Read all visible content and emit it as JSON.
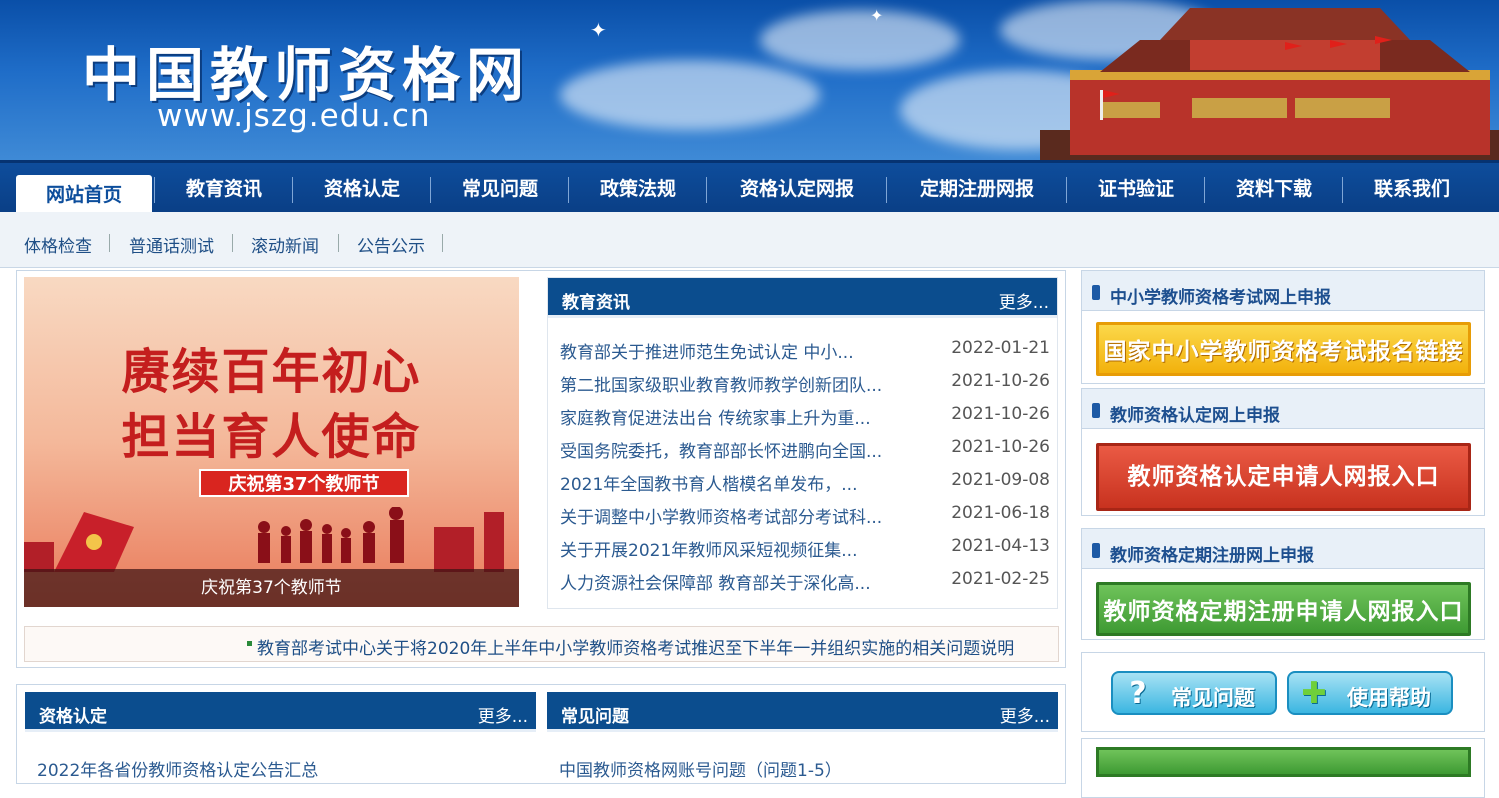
{
  "header": {
    "site_title": "中国教师资格网",
    "site_url": "www.jszg.edu.cn"
  },
  "nav": {
    "items": [
      "网站首页",
      "教育资讯",
      "资格认定",
      "常见问题",
      "政策法规",
      "资格认定网报",
      "定期注册网报",
      "证书验证",
      "资料下载",
      "联系我们"
    ]
  },
  "subnav": {
    "items": [
      "体格检查",
      "普通话测试",
      "滚动新闻",
      "公告公示"
    ]
  },
  "banner": {
    "line1": "赓续百年初心",
    "line2": "担当育人使命",
    "tag": "庆祝第37个教师节",
    "caption": "庆祝第37个教师节"
  },
  "news": {
    "title": "教育资讯",
    "more": "更多...",
    "rows": [
      {
        "title": "教育部关于推进师范生免试认定 中小...",
        "date": "2022-01-21"
      },
      {
        "title": "第二批国家级职业教育教师教学创新团队...",
        "date": "2021-10-26"
      },
      {
        "title": "家庭教育促进法出台 传统家事上升为重...",
        "date": "2021-10-26"
      },
      {
        "title": "受国务院委托，教育部部长怀进鹏向全国...",
        "date": "2021-10-26"
      },
      {
        "title": "2021年全国教书育人楷模名单发布，...",
        "date": "2021-09-08"
      },
      {
        "title": "关于调整中小学教师资格考试部分考试科...",
        "date": "2021-06-18"
      },
      {
        "title": "关于开展2021年教师风采短视频征集...",
        "date": "2021-04-13"
      },
      {
        "title": "人力资源社会保障部 教育部关于深化高...",
        "date": "2021-02-25"
      }
    ]
  },
  "ticker": {
    "text": "教育部考试中心关于将2020年上半年中小学教师资格考试推迟至下半年一并组织实施的相关问题说明"
  },
  "qual_box": {
    "title": "资格认定",
    "more": "更多...",
    "first_item": "2022年各省份教师资格认定公告汇总"
  },
  "faq_box": {
    "title": "常见问题",
    "more": "更多...",
    "first_item": "中国教师资格网账号问题（问题1-5）"
  },
  "right": {
    "sec1_title": "中小学教师资格考试网上申报",
    "sec1_button": "国家中小学教师资格考试报名链接",
    "sec2_title": "教师资格认定网上申报",
    "sec2_button": "教师资格认定申请人网报入口",
    "sec3_title": "教师资格定期注册网上申报",
    "sec3_button": "教师资格定期注册申请人网报入口",
    "faq_button": "常见问题",
    "help_button": "使用帮助"
  },
  "colors": {
    "nav_blue": "#0e4d9c",
    "link_blue": "#2b5a90",
    "btn_yellow": "#f2b10c",
    "btn_red": "#c8321f",
    "btn_green": "#3e9a33"
  }
}
